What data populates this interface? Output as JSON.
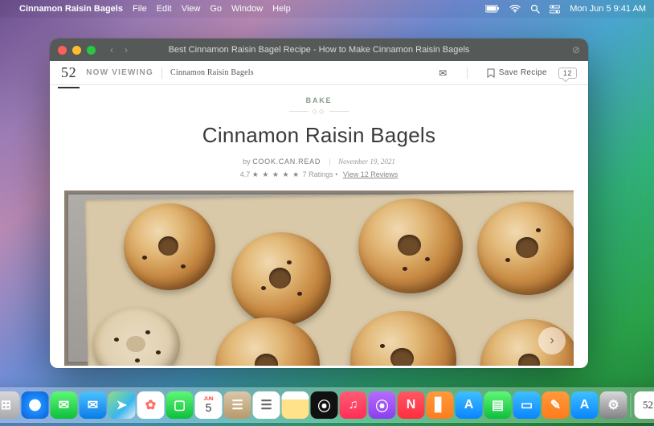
{
  "menubar": {
    "app_name": "Cinnamon Raisin Bagels",
    "items": [
      "File",
      "Edit",
      "View",
      "Go",
      "Window",
      "Help"
    ],
    "clock": "Mon Jun 5 9:41 AM"
  },
  "window": {
    "title": "Best Cinnamon Raisin Bagel Recipe - How to Make Cinnamon Raisin Bagels"
  },
  "siteheader": {
    "logo": "52",
    "now_viewing": "NOW VIEWING",
    "crumb": "Cinnamon Raisin Bagels",
    "save_label": "Save Recipe",
    "comment_count": "12"
  },
  "recipe": {
    "category": "BAKE",
    "title": "Cinnamon Raisin Bagels",
    "by_label": "by",
    "author": "COOK.CAN.READ",
    "date": "November 19, 2021",
    "rating_value": "4.7",
    "ratings_label": "7 Ratings",
    "reviews_label": "View 12 Reviews"
  },
  "dock": {
    "items": [
      {
        "name": "finder",
        "bg": "linear-gradient(180deg,#2fb4ff,#0a84ff)",
        "glyph": "☺"
      },
      {
        "name": "launchpad",
        "bg": "linear-gradient(180deg,#d8d8da,#a9a9ad)",
        "glyph": "⊞"
      },
      {
        "name": "safari",
        "bg": "radial-gradient(circle,#fff 30%,#1e90ff 31%,#0a5fd6 100%)",
        "glyph": "✦"
      },
      {
        "name": "messages",
        "bg": "linear-gradient(180deg,#5ff777,#0dbf3c)",
        "glyph": "✉"
      },
      {
        "name": "mail",
        "bg": "linear-gradient(180deg,#4cc3ff,#0a7be8)",
        "glyph": "✉"
      },
      {
        "name": "maps",
        "bg": "linear-gradient(135deg,#8fe07e,#3ab6f0 60%,#f0f0f0)",
        "glyph": "➤"
      },
      {
        "name": "photos",
        "bg": "#fff",
        "glyph": "✿",
        "fg": "#ff6f61"
      },
      {
        "name": "facetime",
        "bg": "linear-gradient(180deg,#5ff777,#0dbf3c)",
        "glyph": "▢"
      },
      {
        "name": "calendar",
        "bg": "#fff",
        "glyph": "5",
        "fg": "#333",
        "top": "JUN"
      },
      {
        "name": "contacts",
        "bg": "linear-gradient(180deg,#d9c7a8,#b89a6b)",
        "glyph": "☰"
      },
      {
        "name": "reminders",
        "bg": "#fff",
        "glyph": "☰",
        "fg": "#666"
      },
      {
        "name": "notes",
        "bg": "linear-gradient(180deg,#fff,#fff 30%,#ffe28a 30%)",
        "glyph": ""
      },
      {
        "name": "tv",
        "bg": "#111",
        "glyph": "⦿"
      },
      {
        "name": "music",
        "bg": "linear-gradient(180deg,#ff5c74,#ff2d55)",
        "glyph": "♫"
      },
      {
        "name": "podcasts",
        "bg": "linear-gradient(180deg,#b86bff,#8a3ff0)",
        "glyph": "⦿"
      },
      {
        "name": "news",
        "bg": "linear-gradient(180deg,#ff5864,#ff2d3f)",
        "glyph": "N"
      },
      {
        "name": "books",
        "bg": "linear-gradient(180deg,#ff9a3c,#ff7b1c)",
        "glyph": "▋"
      },
      {
        "name": "appstore",
        "bg": "linear-gradient(180deg,#3fc0ff,#0a84ff)",
        "glyph": "A"
      },
      {
        "name": "numbers",
        "bg": "linear-gradient(180deg,#5ff777,#0dbf3c)",
        "glyph": "▤"
      },
      {
        "name": "keynote",
        "bg": "linear-gradient(180deg,#3fc0ff,#0a84ff)",
        "glyph": "▭"
      },
      {
        "name": "pages",
        "bg": "linear-gradient(180deg,#ff9a3c,#ff7b1c)",
        "glyph": "✎"
      },
      {
        "name": "appstore2",
        "bg": "linear-gradient(180deg,#3fc0ff,#0a84ff)",
        "glyph": "A"
      },
      {
        "name": "settings",
        "bg": "linear-gradient(180deg,#d8d8da,#828286)",
        "glyph": "⚙"
      }
    ],
    "right_items": [
      {
        "name": "food52",
        "bg": "#fff",
        "glyph": "52",
        "fg": "#333"
      },
      {
        "name": "trash",
        "bg": "linear-gradient(180deg,#e0e0e0,#b5b5b8)",
        "glyph": "🗑"
      }
    ]
  }
}
